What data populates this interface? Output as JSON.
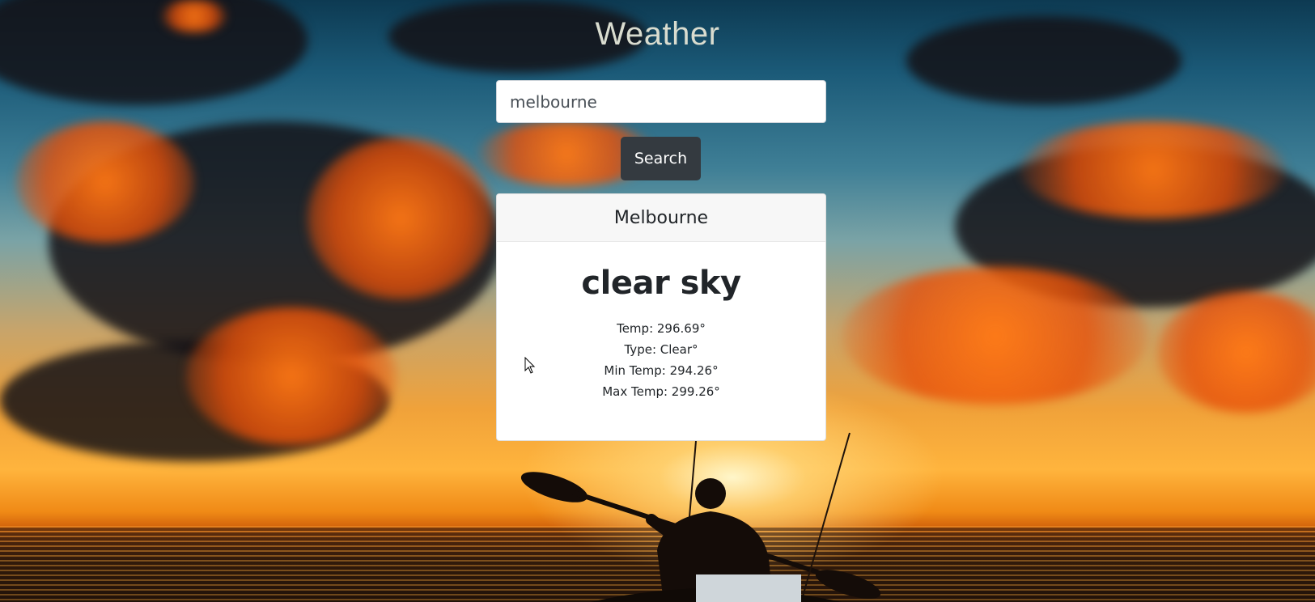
{
  "app": {
    "title": "Weather"
  },
  "search": {
    "value": "melbourne",
    "button_label": "Search"
  },
  "result": {
    "city": "Melbourne",
    "description": "clear sky",
    "temp": "Temp: 296.69°",
    "type": "Type: Clear°",
    "min_temp": "Min Temp: 294.26°",
    "max_temp": "Max Temp: 299.26°"
  },
  "colors": {
    "button_bg": "#343a40",
    "card_header_bg": "#f7f7f7",
    "title_text": "#d9dccf"
  },
  "icons": {
    "cursor": "mouse-pointer-icon"
  }
}
